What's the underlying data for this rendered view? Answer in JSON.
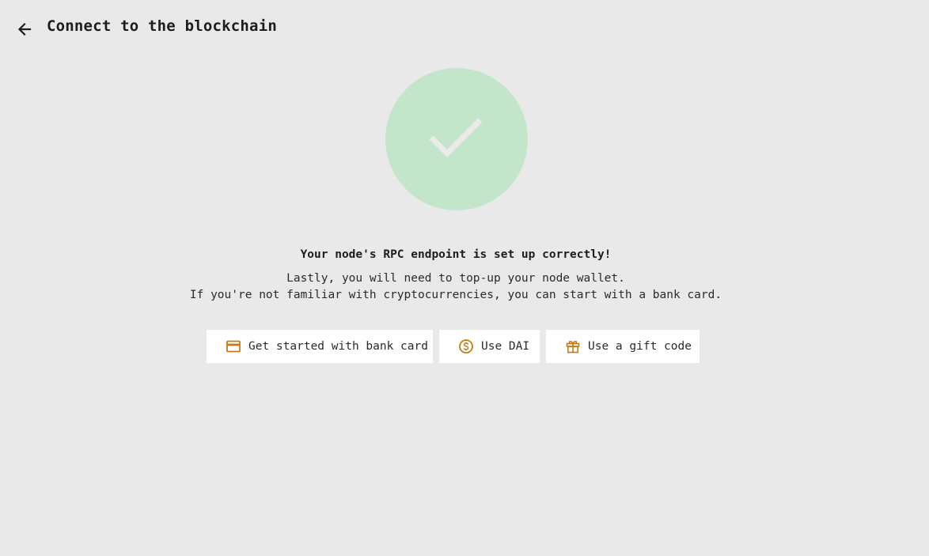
{
  "header": {
    "title": "Connect to the blockchain",
    "back_icon": "arrow-left-icon"
  },
  "status": {
    "icon": "checkmark-icon",
    "heading": "Your node's RPC endpoint is set up correctly!",
    "description_line1": "Lastly, you will need to top-up your node wallet.",
    "description_line2": "If you're not familiar with cryptocurrencies, you can start with a bank card."
  },
  "actions": [
    {
      "label": "Get started with bank card",
      "icon": "credit-card-icon"
    },
    {
      "label": "Use DAI",
      "icon": "dollar-coin-icon"
    },
    {
      "label": "Use a gift code",
      "icon": "gift-icon"
    }
  ],
  "colors": {
    "background": "#e9e9e9",
    "accent": "#c77b14",
    "success_circle": "#c3e6cb",
    "text": "#1c1c1c"
  }
}
